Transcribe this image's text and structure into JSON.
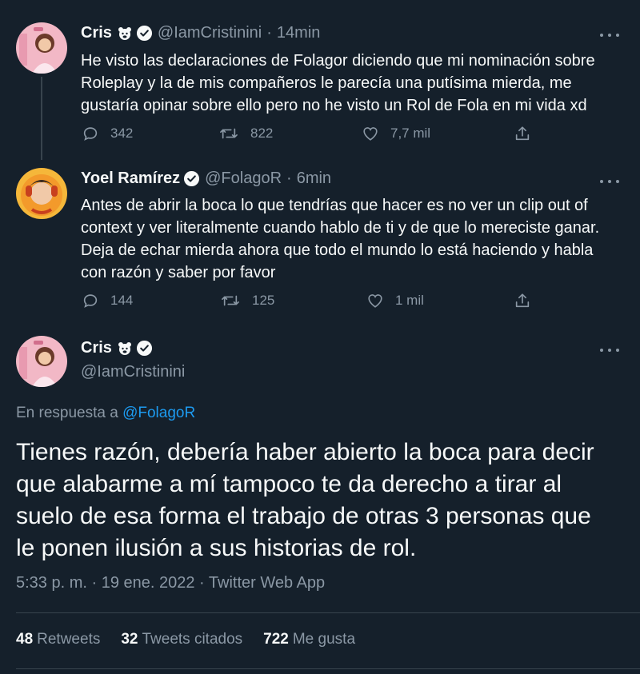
{
  "colors": {
    "background": "#15202b",
    "text": "#f7f9f9",
    "muted": "#8b98a5",
    "link": "#1d9bf0",
    "border": "#38444d"
  },
  "tweets": [
    {
      "name": "Cris",
      "name_glyph": "bear-face-icon",
      "verified": true,
      "handle": "@IamCristinini",
      "separator": "·",
      "time": "14min",
      "lines": [
        "He visto las declaraciones de Folagor diciendo que mi nominación sobre",
        "Roleplay y la de mis compañeros le parecía una putísima mierda, me",
        "gustaría opinar sobre ello pero no he visto un Rol de Fola en mi vida xd"
      ],
      "replies": "342",
      "retweets": "822",
      "likes": "7,7 mil"
    },
    {
      "name": "Yoel Ramírez",
      "verified": true,
      "handle": "@FolagoR",
      "separator": "·",
      "time": "6min",
      "lines": [
        "Antes de abrir la boca lo que tendrías que hacer es no ver un clip out of",
        "context y ver literalmente cuando hablo de ti y de que lo mereciste ganar.",
        "Deja de echar mierda ahora que todo el mundo lo está haciendo y habla",
        "con razón y saber por favor"
      ],
      "replies": "144",
      "retweets": "125",
      "likes": "1 mil"
    }
  ],
  "main_tweet": {
    "name": "Cris",
    "name_glyph": "bear-face-icon",
    "verified": true,
    "handle": "@IamCristinini",
    "reply_prefix": "En respuesta a",
    "reply_to": "@FolagoR",
    "lines": [
      "Tienes razón, debería haber abierto la boca para decir",
      "que alabarme a mí tampoco te da derecho a tirar al",
      "suelo de esa forma el trabajo de otras 3 personas que",
      "le ponen ilusión a sus historias de rol."
    ],
    "meta": "5:33 p. m. · 19 ene. 2022 · Twitter Web App",
    "stats": [
      {
        "count": "48",
        "label": "Retweets"
      },
      {
        "count": "32",
        "label": "Tweets citados"
      },
      {
        "count": "722",
        "label": "Me gusta"
      }
    ]
  }
}
